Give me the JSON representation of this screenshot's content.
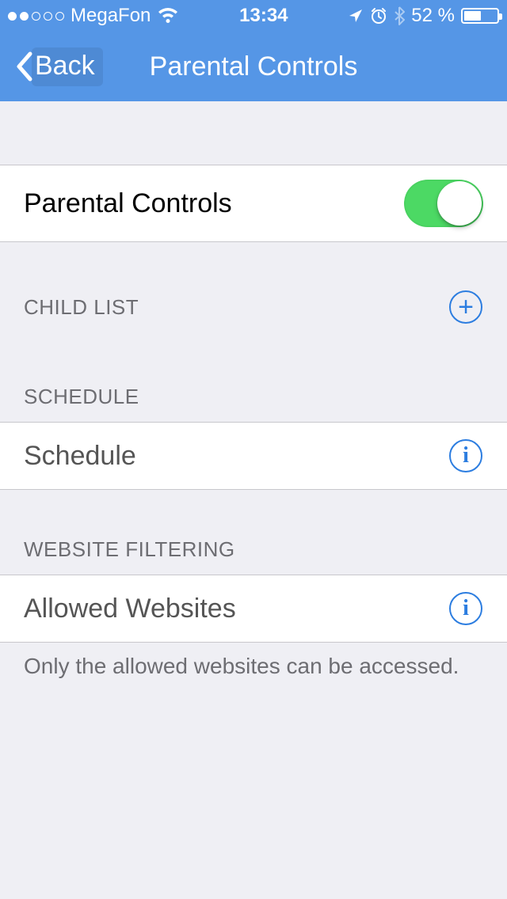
{
  "status": {
    "carrier": "MegaFon",
    "time": "13:34",
    "battery_pct": "52 %"
  },
  "nav": {
    "back": "Back",
    "title": "Parental Controls"
  },
  "rows": {
    "master_toggle_label": "Parental Controls",
    "schedule_label": "Schedule",
    "allowed_sites_label": "Allowed Websites"
  },
  "sections": {
    "child_list": "CHILD LIST",
    "schedule": "SCHEDULE",
    "website_filtering": "WEBSITE FILTERING"
  },
  "footer": {
    "filter_note": "Only the allowed websites can be accessed."
  }
}
